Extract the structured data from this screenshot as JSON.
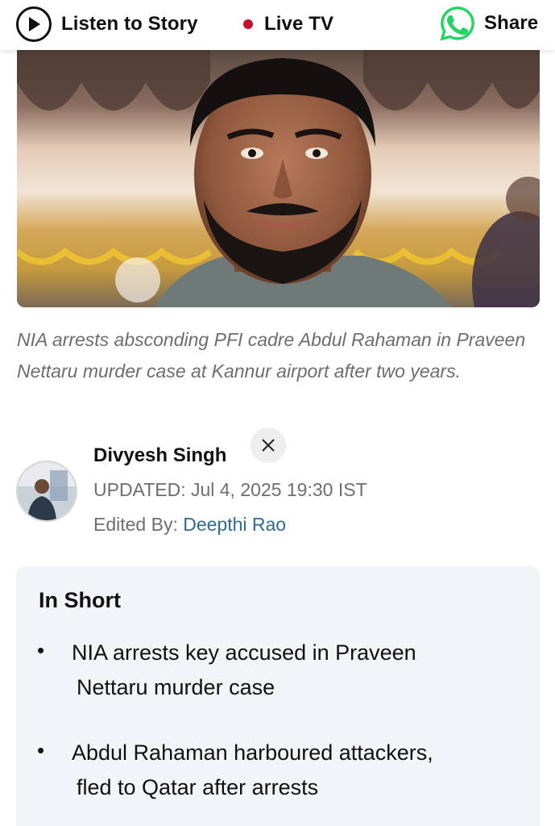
{
  "topbar": {
    "listen_label": "Listen to Story",
    "live_label": "Live TV",
    "share_label": "Share",
    "live_dot_color": "#c8102e",
    "whatsapp_color": "#25d366"
  },
  "hero": {
    "image": "man-portrait-photo"
  },
  "caption": {
    "text": "NIA arrests absconding PFI cadre Abdul Rahaman in Praveen Nettaru murder case at Kannur airport after two years."
  },
  "author": {
    "name": "Divyesh Singh",
    "updated": "UPDATED: Jul 4, 2025 19:30 IST",
    "edited_prefix": "Edited By: ",
    "editor_name": "Deepthi Rao",
    "social_icon": "x-icon",
    "link_color": "#2f6b95"
  },
  "in_short": {
    "title": "In Short",
    "items": [
      {
        "line1": "NIA arrests key accused in Praveen",
        "line2": "Nettaru murder case"
      },
      {
        "line1": "Abdul Rahaman harboured attackers,",
        "line2": "fled to Qatar after arrests"
      }
    ]
  }
}
